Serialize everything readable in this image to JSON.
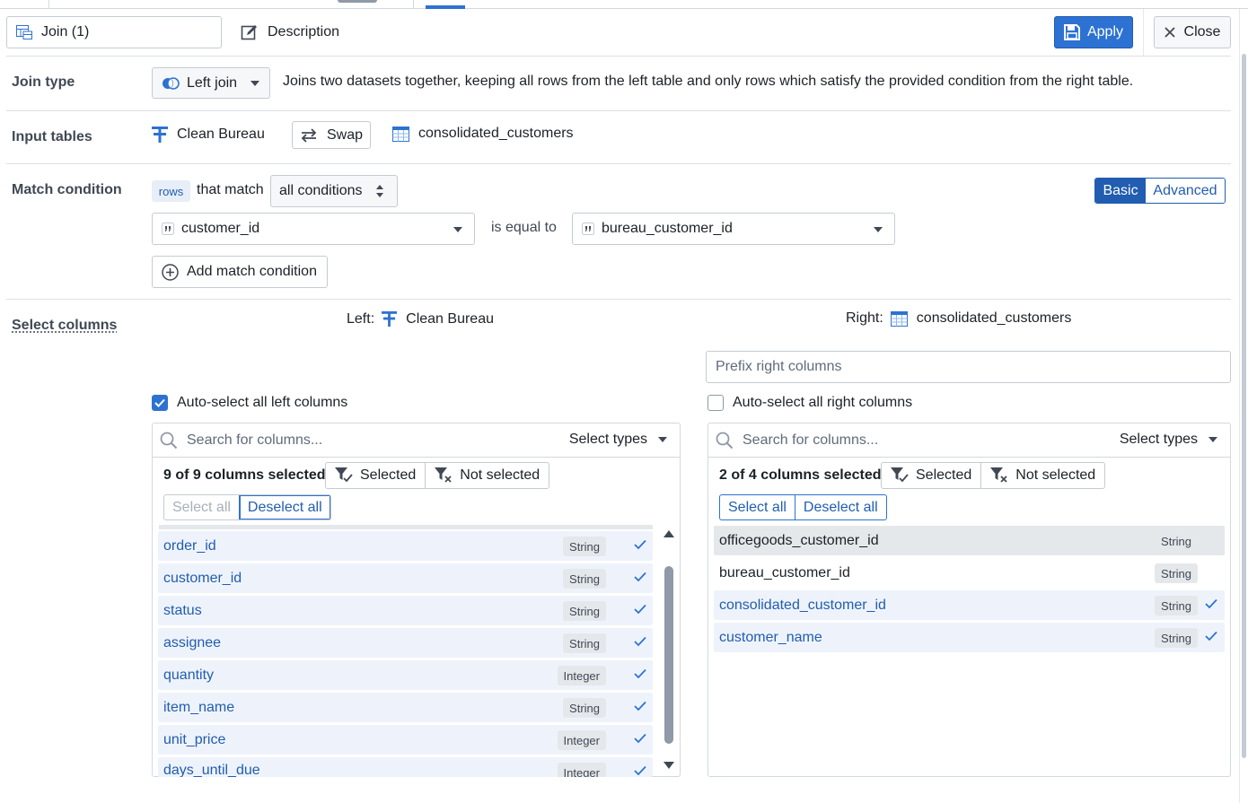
{
  "header": {
    "title_value": "Join (1)",
    "description_label": "Description",
    "apply_label": "Apply",
    "close_label": "Close"
  },
  "join_type": {
    "label": "Join type",
    "selected": "Left join",
    "description": "Joins two datasets together, keeping all rows from the left table and only rows which satisfy the provided condition from the right table."
  },
  "input_tables": {
    "label": "Input tables",
    "left": "Clean Bureau",
    "swap_label": "Swap",
    "right": "consolidated_customers"
  },
  "match_condition": {
    "label": "Match condition",
    "rows_tag": "rows",
    "that_match": "that match",
    "mode": "all conditions",
    "basic_label": "Basic",
    "advanced_label": "Advanced",
    "left_column": "customer_id",
    "operator": "is equal to",
    "right_column": "bureau_customer_id",
    "add_label": "Add match condition"
  },
  "select_columns": {
    "label": "Select columns",
    "left_prefix": "Left:",
    "left_name": "Clean Bureau",
    "right_prefix": "Right:",
    "right_name": "consolidated_customers",
    "prefix_placeholder": "Prefix right columns",
    "left_panel": {
      "auto_label": "Auto-select all left columns",
      "auto_checked": true,
      "search_placeholder": "Search for columns...",
      "types_label": "Select types",
      "count_label": "9 of 9 columns selected",
      "selected_filter": "Selected",
      "not_selected_filter": "Not selected",
      "select_all": "Select all",
      "deselect_all": "Deselect all",
      "columns": [
        {
          "name": "order_id",
          "type": "String",
          "selected": true
        },
        {
          "name": "customer_id",
          "type": "String",
          "selected": true
        },
        {
          "name": "status",
          "type": "String",
          "selected": true
        },
        {
          "name": "assignee",
          "type": "String",
          "selected": true
        },
        {
          "name": "quantity",
          "type": "Integer",
          "selected": true
        },
        {
          "name": "item_name",
          "type": "String",
          "selected": true
        },
        {
          "name": "unit_price",
          "type": "Integer",
          "selected": true
        },
        {
          "name": "days_until_due",
          "type": "Integer",
          "selected": true
        }
      ]
    },
    "right_panel": {
      "auto_label": "Auto-select all right columns",
      "auto_checked": false,
      "search_placeholder": "Search for columns...",
      "types_label": "Select types",
      "count_label": "2 of 4 columns selected",
      "selected_filter": "Selected",
      "not_selected_filter": "Not selected",
      "select_all": "Select all",
      "deselect_all": "Deselect all",
      "columns": [
        {
          "name": "officegoods_customer_id",
          "type": "String",
          "selected": false
        },
        {
          "name": "bureau_customer_id",
          "type": "String",
          "selected": false
        },
        {
          "name": "consolidated_customer_id",
          "type": "String",
          "selected": true
        },
        {
          "name": "customer_name",
          "type": "String",
          "selected": true
        }
      ]
    }
  },
  "colors": {
    "accent": "#2d72d2",
    "accent_dark": "#215db0",
    "selected_row_bg": "#eef3fb"
  }
}
